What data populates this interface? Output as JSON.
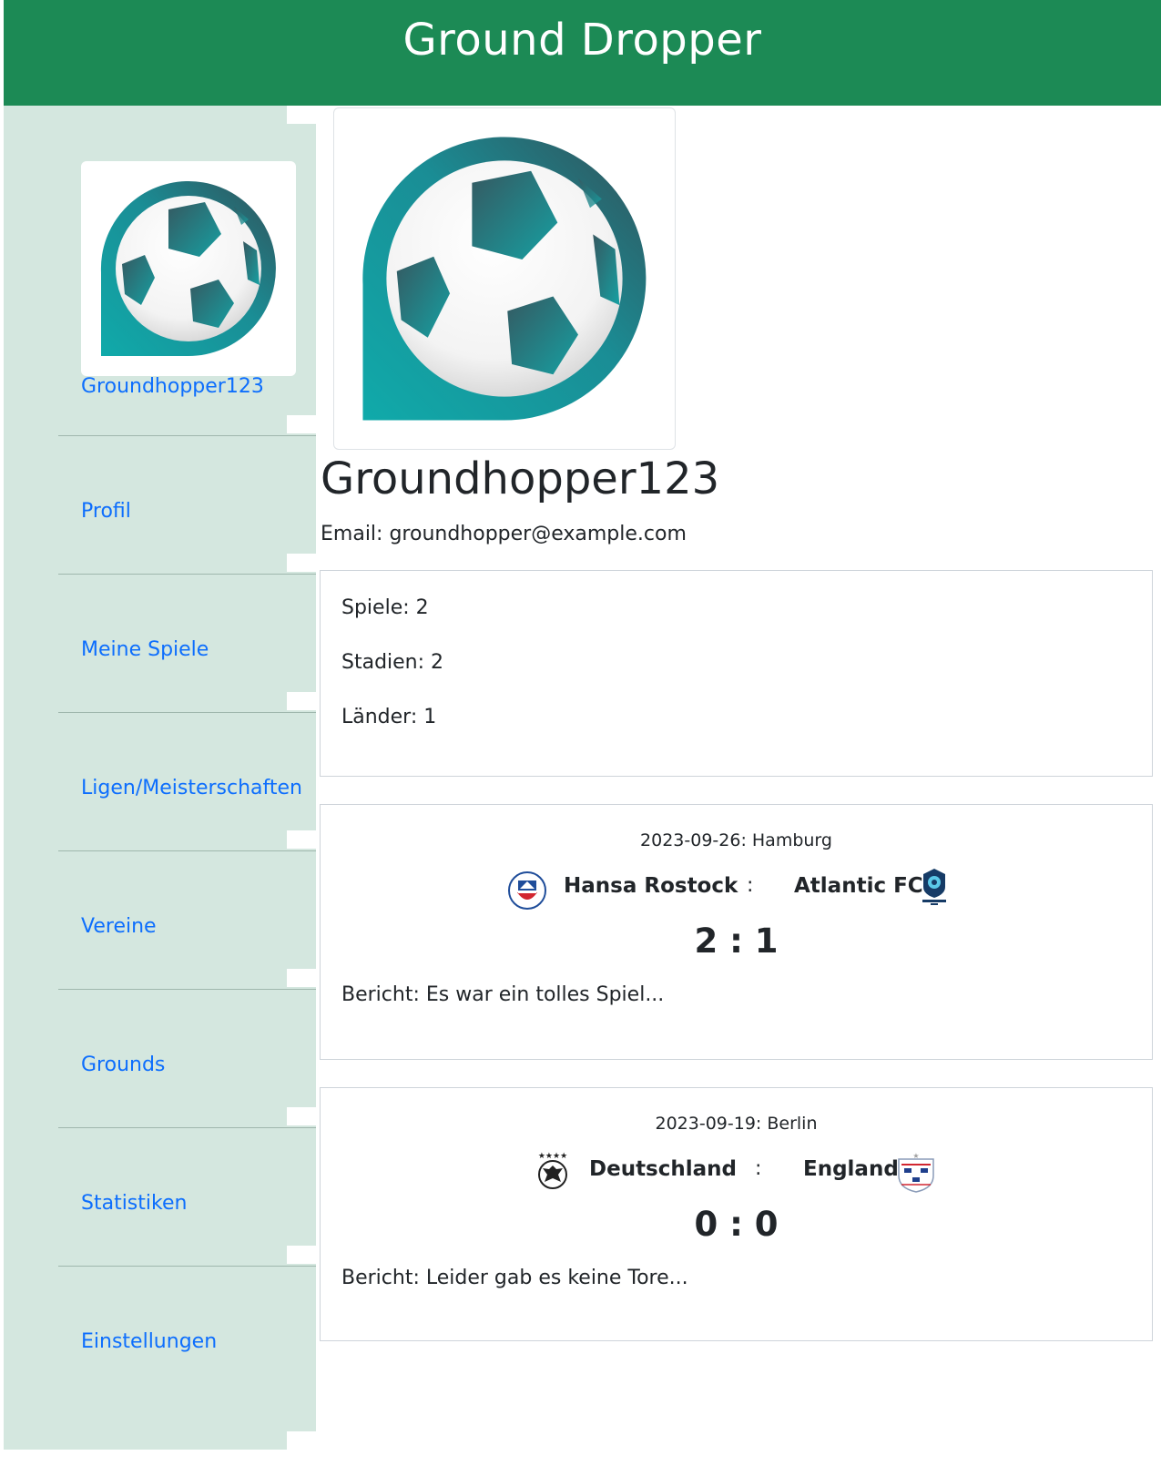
{
  "header": {
    "title": "Ground Dropper"
  },
  "sidebar": {
    "username": "Groundhopper123",
    "items": [
      {
        "label": "Profil"
      },
      {
        "label": "Meine Spiele"
      },
      {
        "label": "Ligen/Meisterschaften"
      },
      {
        "label": "Vereine"
      },
      {
        "label": "Grounds"
      },
      {
        "label": "Statistiken"
      },
      {
        "label": "Einstellungen"
      }
    ]
  },
  "profile": {
    "username": "Groundhopper123",
    "email_label": "Email:",
    "email": "groundhopper@example.com"
  },
  "stats": [
    {
      "label": "Spiele:",
      "value": "2"
    },
    {
      "label": "Stadien:",
      "value": "2"
    },
    {
      "label": "Länder:",
      "value": "1"
    }
  ],
  "matches": [
    {
      "date": "2023-09-26",
      "city": "Hamburg",
      "home": "Hansa Rostock",
      "away": "Atlantic FC",
      "separator": ":",
      "score": "2 : 1",
      "report_label": "Bericht:",
      "report": "Es war ein tolles Spiel..."
    },
    {
      "date": "2023-09-19",
      "city": "Berlin",
      "home": "Deutschland",
      "away": "England",
      "separator": ":",
      "score": "0 : 0",
      "report_label": "Bericht:",
      "report": "Leider gab es keine Tore..."
    }
  ],
  "colors": {
    "header": "#1c8a55",
    "sidebar": "#d4e7df",
    "link": "#0d6efd",
    "ball_teal": "#13a4a6",
    "ball_dark": "#2d5a63"
  },
  "icons": {
    "avatar": "soccer-ball-logo",
    "hansa_crest": "hansa-rostock-crest",
    "atlantic_crest": "atlantic-fc-crest",
    "dfb_crest": "dfb-eagle-crest",
    "england_crest": "three-lions-crest"
  }
}
